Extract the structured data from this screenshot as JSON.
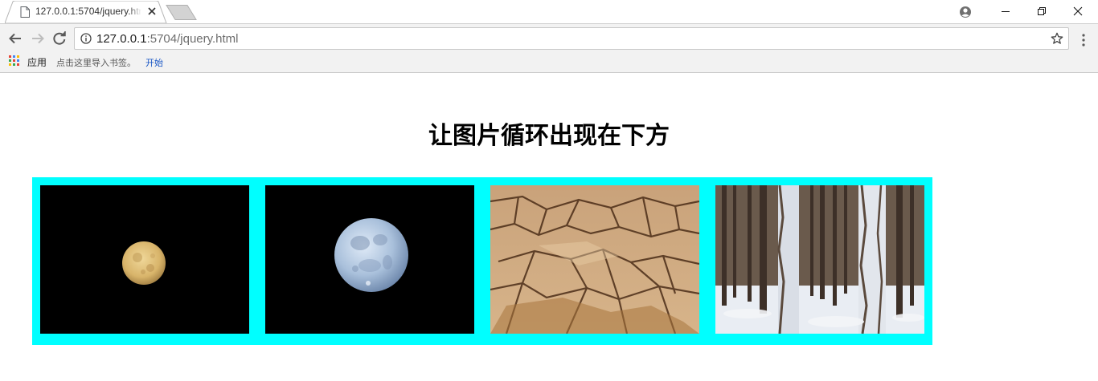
{
  "browser": {
    "tab": {
      "title": "127.0.0.1:5704/jquery.html"
    },
    "address": {
      "host": "127.0.0.1",
      "rest": ":5704/jquery.html"
    },
    "bookmarks": {
      "apps_label": "应用",
      "import_text": "点击这里导入书签。",
      "start_link": "开始"
    }
  },
  "page": {
    "heading": "让图片循环出现在下方",
    "strip_color": "#00ffff",
    "images": [
      {
        "name": "full-moon-golden",
        "alt": "golden full moon on black sky"
      },
      {
        "name": "full-moon-blue",
        "alt": "blue full moon on black sky"
      },
      {
        "name": "cracked-earth",
        "alt": "dry cracked earth"
      },
      {
        "name": "snowy-forest",
        "alt": "snow covered birch forest"
      }
    ]
  }
}
